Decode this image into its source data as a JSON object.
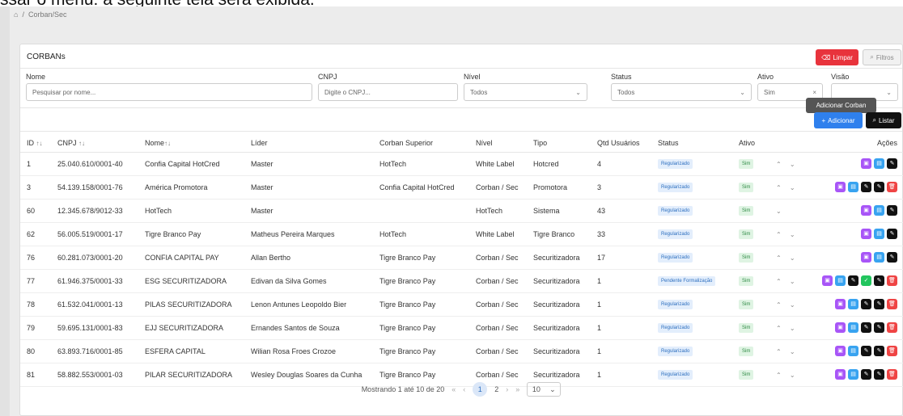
{
  "caption": "ssar o menu: a seguinte tela será exibida.",
  "breadcrumb": {
    "home_icon": "home-icon",
    "separator": "/",
    "current": "Corban/Sec"
  },
  "card": {
    "title": "CORBANs"
  },
  "header_buttons": {
    "limpar": "Limpar",
    "filtros": "Filtros"
  },
  "filters": {
    "nome": {
      "label": "Nome",
      "placeholder": "Pesquisar por nome..."
    },
    "cnpj": {
      "label": "CNPJ",
      "placeholder": "Digite o CNPJ..."
    },
    "nivel": {
      "label": "Nível",
      "value": "Todos"
    },
    "status": {
      "label": "Status",
      "value": "Todos"
    },
    "ativo": {
      "label": "Ativo",
      "value": "Sim"
    },
    "visao": {
      "label": "Visão",
      "value": ""
    }
  },
  "tooltip": "Adicionar Corban",
  "toolbar": {
    "adicionar": "Adicionar",
    "listar": "Listar"
  },
  "columns": [
    "ID",
    "CNPJ",
    "Nome",
    "Líder",
    "Corban Superior",
    "Nível",
    "Tipo",
    "Qtd Usuários",
    "Status",
    "Ativo",
    "",
    "Ações"
  ],
  "rows": [
    {
      "id": "1",
      "cnpj": "25.040.610/0001-40",
      "nome": "Confia Capital HotCred",
      "lider": "Master",
      "superior": "HotTech",
      "nivel": "White Label",
      "tipo": "Hotcred",
      "qtd": "4",
      "status": "Regularizado",
      "ativo": "Sim",
      "arrows": "⌃ ⌄",
      "acts": [
        "purple",
        "blue",
        "black"
      ]
    },
    {
      "id": "3",
      "cnpj": "54.139.158/0001-76",
      "nome": "América Promotora",
      "lider": "Master",
      "superior": "Confia Capital HotCred",
      "nivel": "Corban / Sec",
      "tipo": "Promotora",
      "qtd": "3",
      "status": "Regularizado",
      "ativo": "Sim",
      "arrows": "⌃ ⌄",
      "acts": [
        "purple",
        "blue",
        "black",
        "black",
        "red"
      ]
    },
    {
      "id": "60",
      "cnpj": "12.345.678/9012-33",
      "nome": "HotTech",
      "lider": "Master",
      "superior": "",
      "nivel": "HotTech",
      "tipo": "Sistema",
      "qtd": "43",
      "status": "Regularizado",
      "ativo": "Sim",
      "arrows": "⌄",
      "acts": [
        "purple",
        "blue",
        "black"
      ]
    },
    {
      "id": "62",
      "cnpj": "56.005.519/0001-17",
      "nome": "Tigre Branco Pay",
      "lider": "Matheus Pereira Marques",
      "superior": "HotTech",
      "nivel": "White Label",
      "tipo": "Tigre Branco",
      "qtd": "33",
      "status": "Regularizado",
      "ativo": "Sim",
      "arrows": "⌃ ⌄",
      "acts": [
        "purple",
        "blue",
        "black"
      ]
    },
    {
      "id": "76",
      "cnpj": "60.281.073/0001-20",
      "nome": "CONFIA CAPITAL PAY",
      "lider": "Allan Bertho",
      "superior": "Tigre Branco Pay",
      "nivel": "Corban / Sec",
      "tipo": "Securitizadora",
      "qtd": "17",
      "status": "Regularizado",
      "ativo": "Sim",
      "arrows": "⌃ ⌄",
      "acts": [
        "purple",
        "blue",
        "black"
      ]
    },
    {
      "id": "77",
      "cnpj": "61.946.375/0001-33",
      "nome": "ESG SECURITIZADORA",
      "lider": "Edivan da Silva Gomes",
      "superior": "Tigre Branco Pay",
      "nivel": "Corban / Sec",
      "tipo": "Securitizadora",
      "qtd": "1",
      "status": "Pendente Formalização",
      "ativo": "Sim",
      "arrows": "⌃ ⌄",
      "acts": [
        "purple",
        "blue",
        "black",
        "green",
        "black",
        "red"
      ]
    },
    {
      "id": "78",
      "cnpj": "61.532.041/0001-13",
      "nome": "PILAS SECURITIZADORA",
      "lider": "Lenon Antunes Leopoldo Bier",
      "superior": "Tigre Branco Pay",
      "nivel": "Corban / Sec",
      "tipo": "Securitizadora",
      "qtd": "1",
      "status": "Regularizado",
      "ativo": "Sim",
      "arrows": "⌃ ⌄",
      "acts": [
        "purple",
        "blue",
        "black",
        "black",
        "red"
      ]
    },
    {
      "id": "79",
      "cnpj": "59.695.131/0001-83",
      "nome": "EJJ SECURITIZADORA",
      "lider": "Ernandes Santos de Souza",
      "superior": "Tigre Branco Pay",
      "nivel": "Corban / Sec",
      "tipo": "Securitizadora",
      "qtd": "1",
      "status": "Regularizado",
      "ativo": "Sim",
      "arrows": "⌃ ⌄",
      "acts": [
        "purple",
        "blue",
        "black",
        "black",
        "red"
      ]
    },
    {
      "id": "80",
      "cnpj": "63.893.716/0001-85",
      "nome": "ESFERA CAPITAL",
      "lider": "Wilian Rosa Froes Crozoe",
      "superior": "Tigre Branco Pay",
      "nivel": "Corban / Sec",
      "tipo": "Securitizadora",
      "qtd": "1",
      "status": "Regularizado",
      "ativo": "Sim",
      "arrows": "⌃ ⌄",
      "acts": [
        "purple",
        "blue",
        "black",
        "black",
        "red"
      ]
    },
    {
      "id": "81",
      "cnpj": "58.882.553/0001-03",
      "nome": "PILAR SECURITIZADORA",
      "lider": "Wesley Douglas Soares da Cunha",
      "superior": "Tigre Branco Pay",
      "nivel": "Corban / Sec",
      "tipo": "Securitizadora",
      "qtd": "1",
      "status": "Regularizado",
      "ativo": "Sim",
      "arrows": "⌃ ⌄",
      "acts": [
        "purple",
        "blue",
        "black",
        "black",
        "red"
      ]
    }
  ],
  "pagination": {
    "summary": "Mostrando 1 até 10 de 20",
    "first": "«",
    "prev": "‹",
    "page1": "1",
    "page2": "2",
    "next": "›",
    "last": "»",
    "page_size": "10"
  },
  "colors": {
    "purple": "#a855f7",
    "blue": "#38a3f0",
    "black": "#111111",
    "red": "#ef4444",
    "green": "#22c55e",
    "primary": "#2f80ed",
    "danger": "#e8333c"
  }
}
